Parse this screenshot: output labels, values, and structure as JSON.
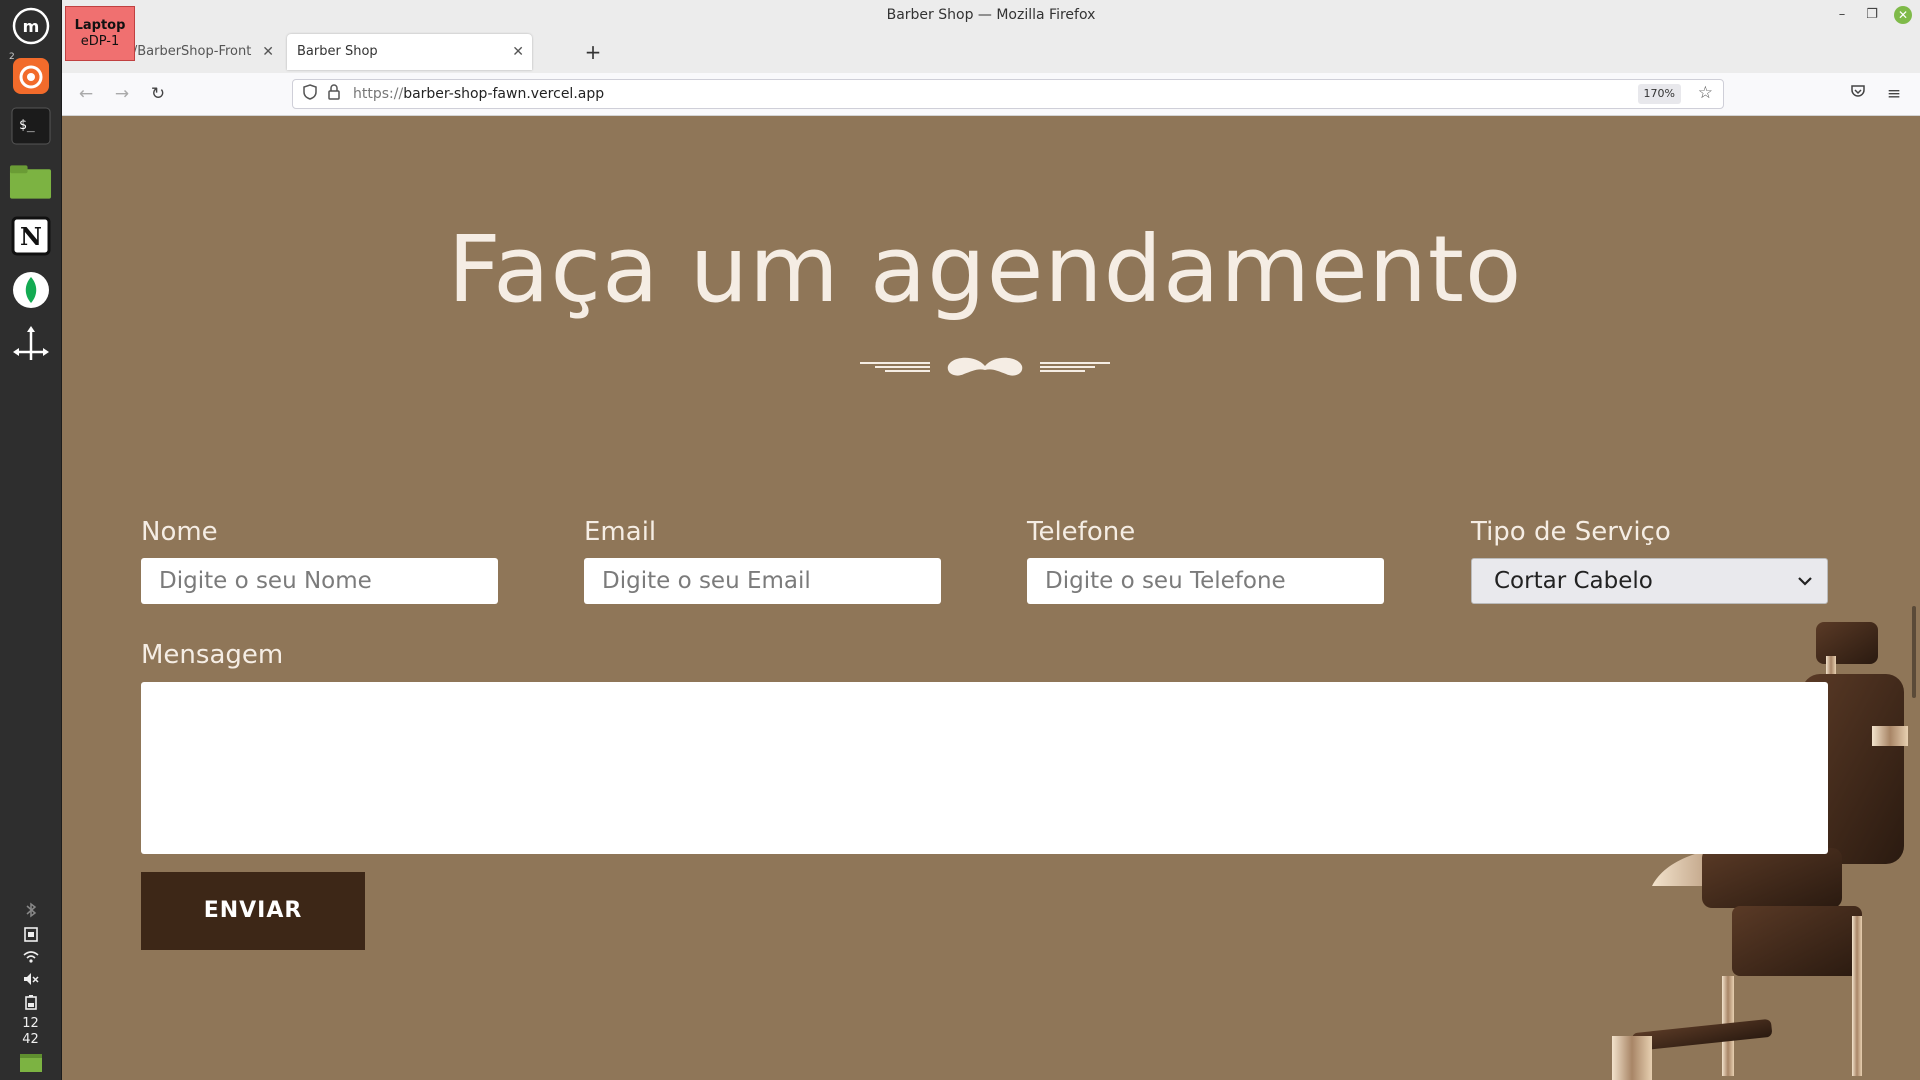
{
  "dock": {
    "workspace": "2",
    "clock_hour": "12",
    "clock_min": "42"
  },
  "display_badge": {
    "title": "Laptop",
    "subtitle": "eDP-1"
  },
  "window": {
    "title": "Barber Shop — Mozilla Firefox"
  },
  "tabs": [
    {
      "label": "walkerrr/BarberShop-Front",
      "active": false
    },
    {
      "label": "Barber Shop",
      "active": true
    }
  ],
  "navbar": {
    "url_scheme": "https://",
    "url_host": "barber-shop-fawn.vercel.app",
    "zoom": "170%"
  },
  "page": {
    "heading": "Faça um agendamento",
    "form": {
      "name_label": "Nome",
      "name_placeholder": "Digite o seu Nome",
      "email_label": "Email",
      "email_placeholder": "Digite o seu Email",
      "phone_label": "Telefone",
      "phone_placeholder": "Digite o seu Telefone",
      "service_label": "Tipo de Serviço",
      "service_selected": "Cortar Cabelo",
      "message_label": "Mensagem",
      "submit_label": "ENVIAR"
    }
  },
  "colors": {
    "page_bg": "#8f7658",
    "text_light": "#f5ede4",
    "button_bg": "#3d2717"
  }
}
